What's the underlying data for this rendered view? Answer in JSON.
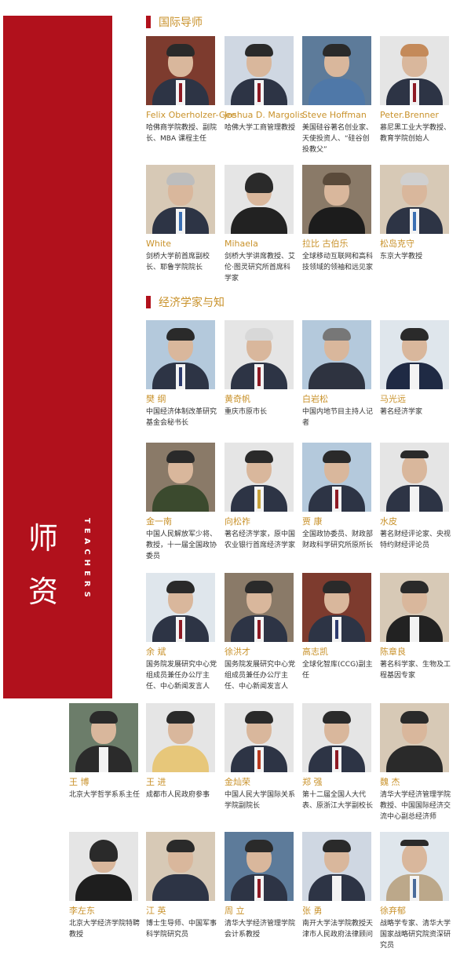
{
  "side": {
    "title_line1": "师",
    "title_line2": "资",
    "subtitle": "TEACHERS"
  },
  "sections": {
    "international": "国际导师",
    "economists": "经济学家与知"
  },
  "international_mentors": [
    {
      "name": "Felix Oberholzer-Gee",
      "title": "哈佛商学院教授、副院长、MBA 课程主任"
    },
    {
      "name": "Joshua D. Margolis",
      "title": "哈佛大学工商管理教授"
    },
    {
      "name": "Steve Hoffman",
      "title": "美国硅谷著名创业家、天使投资人、“硅谷创投教父”"
    },
    {
      "name": "Peter.Brenner",
      "title": "慕尼黑工业大学教授、教育学院创始人"
    },
    {
      "name": "White",
      "title": "剑桥大学前首席副校长、耶鲁学院院长"
    },
    {
      "name": "Mihaela",
      "title": "剑桥大学讲席教授、艾伦·图灵研究所首席科学家"
    },
    {
      "name": "拉比 古伯乐",
      "title": "全球移动互联网和高科技领域的领袖和远见家"
    },
    {
      "name": "松岛克守",
      "title": "东京大学教授"
    }
  ],
  "economists": [
    {
      "name": "樊 纲",
      "title": "中国经济体制改革研究基金会秘书长"
    },
    {
      "name": "黄奇帆",
      "title": "重庆市原市长"
    },
    {
      "name": "白岩松",
      "title": "中国内地节目主持人记者"
    },
    {
      "name": "马光远",
      "title": "著名经济学家"
    },
    {
      "name": "金一南",
      "title": "中国人民解放军少将、教授，十一届全国政协委员"
    },
    {
      "name": "向松祚",
      "title": "著名经济学家，原中国农业银行首席经济学家"
    },
    {
      "name": "贾 康",
      "title": "全国政协委员、财政部财政科学研究所原所长"
    },
    {
      "name": "水皮",
      "title": "著名财经评论家、央视特约财经评论员"
    },
    {
      "name": "余 斌",
      "title": "国务院发展研究中心党组成员兼任办公厅主任、中心新闻发言人"
    },
    {
      "name": "徐洪才",
      "title": "国务院发展研究中心党组成员兼任办公厅主任、中心新闻发言人"
    },
    {
      "name": "高志凯",
      "title": "全球化智库(CCG)副主任"
    },
    {
      "name": "陈章良",
      "title": "著名科学家、生物及工程基因专家"
    }
  ],
  "row5": [
    {
      "name": "王 博",
      "title": "北京大学哲学系系主任"
    },
    {
      "name": "王 进",
      "title": "成都市人民政府参事"
    },
    {
      "name": "金灿荣",
      "title": "中国人民大学国际关系学院副院长"
    },
    {
      "name": "郑 强",
      "title": "第十二届全国人大代表、原浙江大学副校长"
    },
    {
      "name": "魏 杰",
      "title": "清华大学经济管理学院教授、中国国际经济交流中心副总经济师"
    }
  ],
  "row6": [
    {
      "name": "李左东",
      "title": "北京大学经济学院特聘教授"
    },
    {
      "name": "江 英",
      "title": "博士生导师、中国军事科学院研究员"
    },
    {
      "name": "周 立",
      "title": "清华大学经济管理学院会计系教授"
    },
    {
      "name": "张 勇",
      "title": "南开大学法学院教授天津市人民政府法律顾问"
    },
    {
      "name": "徐弃郁",
      "title": "战略学专家、清华大学国家战略研究院资深研究员"
    }
  ]
}
